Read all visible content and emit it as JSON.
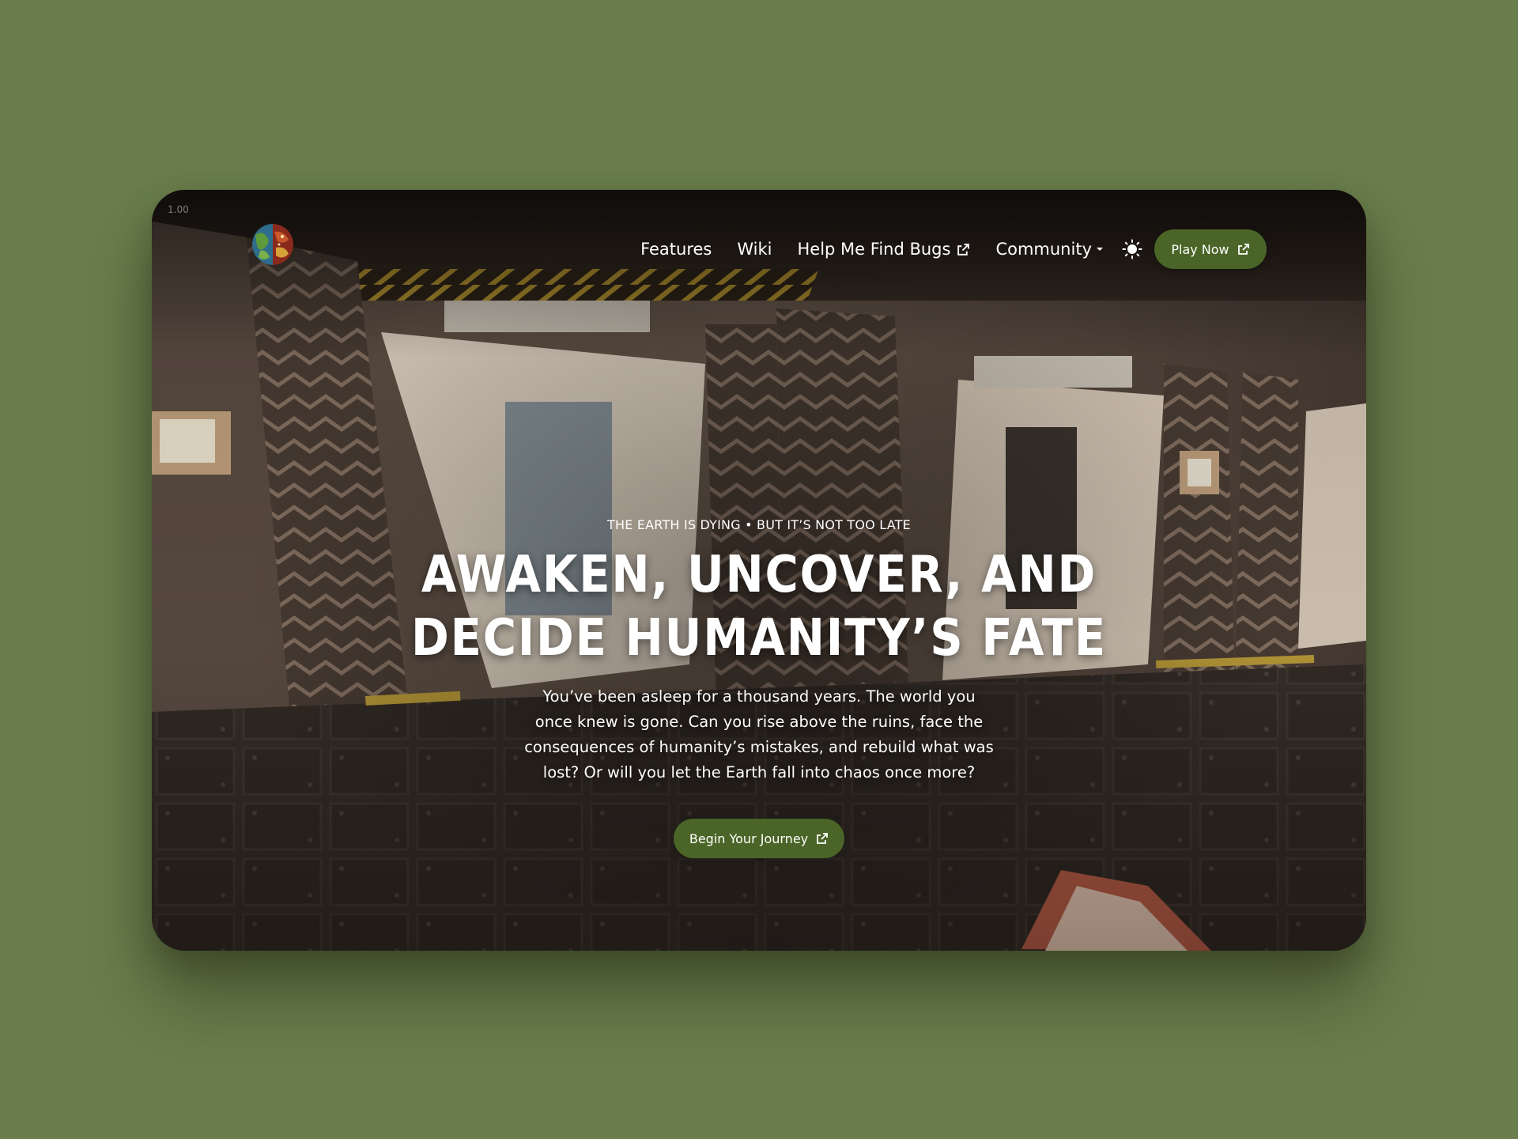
{
  "meta": {
    "scale_label": "1.00"
  },
  "logo": {
    "icon": "globe-logo-icon"
  },
  "nav": {
    "items": [
      {
        "label": "Features"
      },
      {
        "label": "Wiki"
      },
      {
        "label": "Help Me Find Bugs",
        "icon": "external-link-icon"
      },
      {
        "label": "Community",
        "icon": "caret-down-icon"
      }
    ],
    "theme_toggle_icon": "sun-icon",
    "play_label": "Play Now",
    "play_icon": "external-link-icon"
  },
  "hero": {
    "eyebrow": "THE EARTH IS DYING • BUT IT’S NOT TOO LATE",
    "headline_line1": "AWAKEN, UNCOVER, AND",
    "headline_line2": "DECIDE HUMANITY’S FATE",
    "body": "You’ve been asleep for a thousand years. The world you once knew is gone. Can you rise above the ruins, face the consequences of humanity’s mistakes, and rebuild what was lost? Or will you let the Earth fall into chaos once more?",
    "cta_label": "Begin Your Journey",
    "cta_icon": "external-link-icon"
  },
  "colors": {
    "background": "#6a7d4c",
    "accent_button": "#4a6527",
    "text": "#ffffff"
  }
}
